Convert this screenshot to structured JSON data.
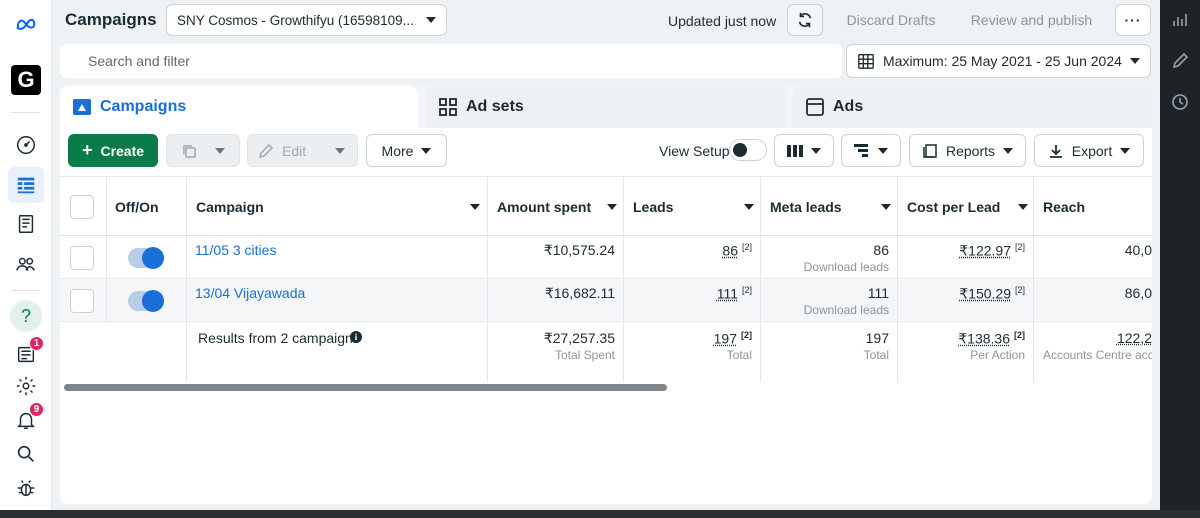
{
  "header": {
    "title": "Campaigns",
    "account": "SNY Cosmos - Growthifyu (16598109...",
    "updated": "Updated just now",
    "discard": "Discard Drafts",
    "review": "Review and publish",
    "more": "···"
  },
  "search": {
    "placeholder": "Search and filter"
  },
  "date_range": "Maximum: 25 May 2021 - 25 Jun 2024",
  "rail": {
    "badge_messages": "1",
    "badge_notifications": "9",
    "logo_letter": "G",
    "help": "?"
  },
  "tabs": [
    {
      "label": "Campaigns",
      "active": true
    },
    {
      "label": "Ad sets",
      "active": false
    },
    {
      "label": "Ads",
      "active": false
    }
  ],
  "toolbar": {
    "create": "Create",
    "edit": "Edit",
    "more": "More",
    "view_setup": "View Setup",
    "reports": "Reports",
    "export": "Export"
  },
  "table": {
    "columns": [
      "Off/On",
      "Campaign",
      "Amount spent",
      "Leads",
      "Meta leads",
      "Cost per Lead",
      "Reach"
    ],
    "rows": [
      {
        "name": "11/05 3 cities",
        "amount": "₹10,575.24",
        "leads": "86",
        "leads_sup": "[2]",
        "meta_leads": "86",
        "meta_leads_sub": "Download leads",
        "cpl": "₹122.97",
        "cpl_sup": "[2]",
        "reach": "40,0"
      },
      {
        "name": "13/04 Vijayawada",
        "amount": "₹16,682.11",
        "leads": "111",
        "leads_sup": "[2]",
        "meta_leads": "111",
        "meta_leads_sub": "Download leads",
        "cpl": "₹150.29",
        "cpl_sup": "[2]",
        "reach": "86,0"
      }
    ],
    "totals": {
      "label": "Results from 2 campaigns",
      "amount": "₹27,257.35",
      "amount_sub": "Total Spent",
      "leads": "197",
      "leads_sup": "[2]",
      "leads_sub": "Total",
      "meta_leads": "197",
      "meta_leads_sub": "Total",
      "cpl": "₹138.36",
      "cpl_sup": "[2]",
      "cpl_sub": "Per Action",
      "reach": "122,2",
      "reach_sub": "Accounts Centre acco"
    }
  },
  "colors": {
    "brand_blue": "#1a6ed8",
    "create_green": "#0a7c4a",
    "badge_red": "#e0245e"
  }
}
